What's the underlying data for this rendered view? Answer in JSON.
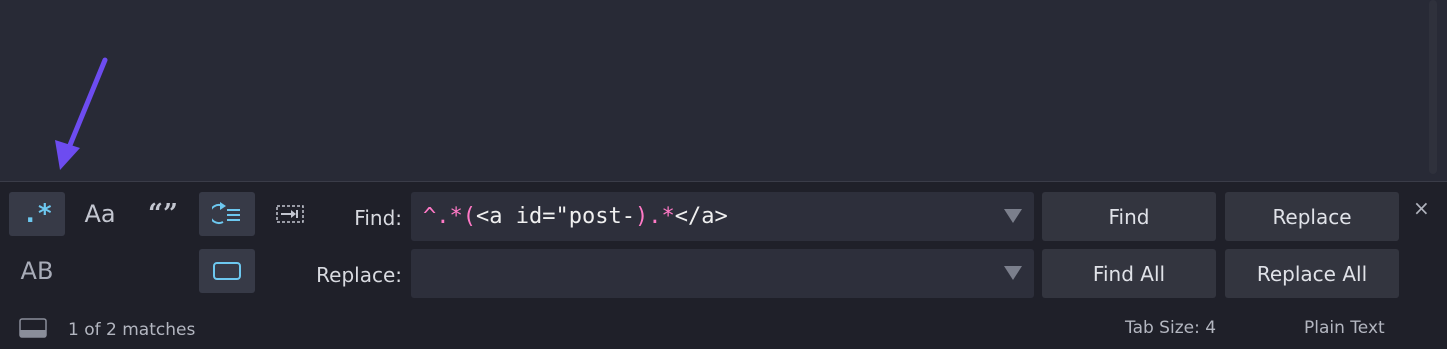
{
  "colors": {
    "regex_pink": "#ff79c6",
    "accent": "#6dc8f0",
    "annotation_arrow": "#6d4cf0"
  },
  "toggles": {
    "regex": ".*",
    "case": "Aa",
    "whole_word": "“”",
    "preserve_case": "AB"
  },
  "icons": {
    "wrap": "wrap-icon",
    "in_selection": "in-selection-icon",
    "highlight": "highlight-matches-icon",
    "panel_toggle": "panel-toggle-icon",
    "close": "close-icon"
  },
  "find": {
    "label": "Find:",
    "value_parts": [
      {
        "text": "^",
        "kind": "op"
      },
      {
        "text": ".*",
        "kind": "op"
      },
      {
        "text": "(",
        "kind": "op"
      },
      {
        "text": "<a id=\"post-",
        "kind": "lit"
      },
      {
        "text": ")",
        "kind": "op"
      },
      {
        "text": ".*",
        "kind": "op"
      },
      {
        "text": "</a>",
        "kind": "lit"
      }
    ]
  },
  "replace": {
    "label": "Replace:",
    "value": ""
  },
  "buttons": {
    "find": "Find",
    "replace": "Replace",
    "find_all": "Find All",
    "replace_all": "Replace All",
    "close": "×"
  },
  "status": {
    "matches": "1 of 2 matches",
    "tab_size": "Tab Size: 4",
    "syntax": "Plain Text"
  }
}
